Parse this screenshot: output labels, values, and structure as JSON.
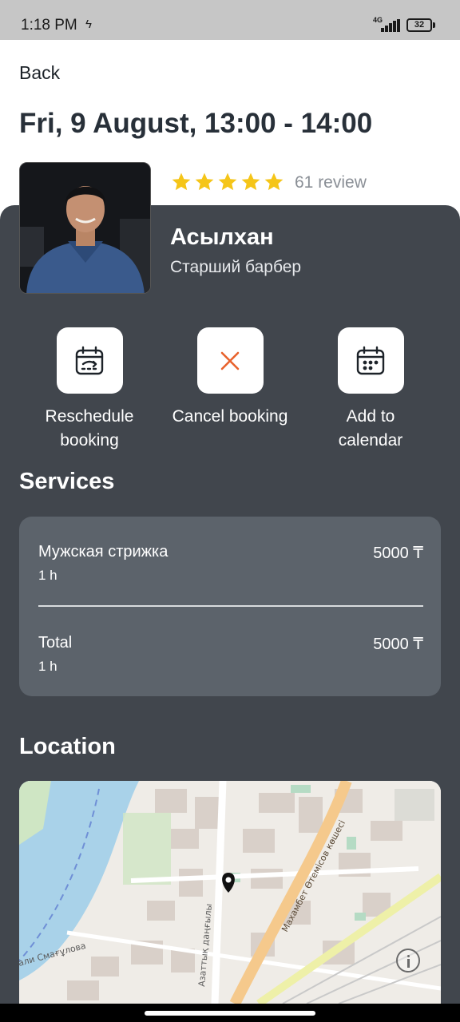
{
  "status_bar": {
    "time": "1:18 PM",
    "network": "4G",
    "battery": "32"
  },
  "header": {
    "back_label": "Back",
    "title": "Fri, 9 August, 13:00 - 14:00"
  },
  "master": {
    "rating": 5,
    "reviews": "61 review",
    "name": "Асылхан",
    "role": "Старший барбер"
  },
  "actions": {
    "reschedule": "Reschedule booking",
    "cancel": "Cancel booking",
    "calendar": "Add to calendar"
  },
  "services": {
    "title": "Services",
    "items": [
      {
        "name": "Мужская стрижка",
        "duration": "1 h",
        "price": "5000 ₸"
      }
    ],
    "total": {
      "label": "Total",
      "duration": "1 h",
      "price": "5000 ₸"
    }
  },
  "location": {
    "title": "Location",
    "street_labels": [
      "Махамбет Өтемісов көшесі",
      "Азаттық даңғылы",
      "али Смағұлова"
    ]
  },
  "colors": {
    "panel": "#41464d",
    "card": "#5c636b",
    "star": "#f5c518",
    "cancel_icon": "#e8622c"
  }
}
